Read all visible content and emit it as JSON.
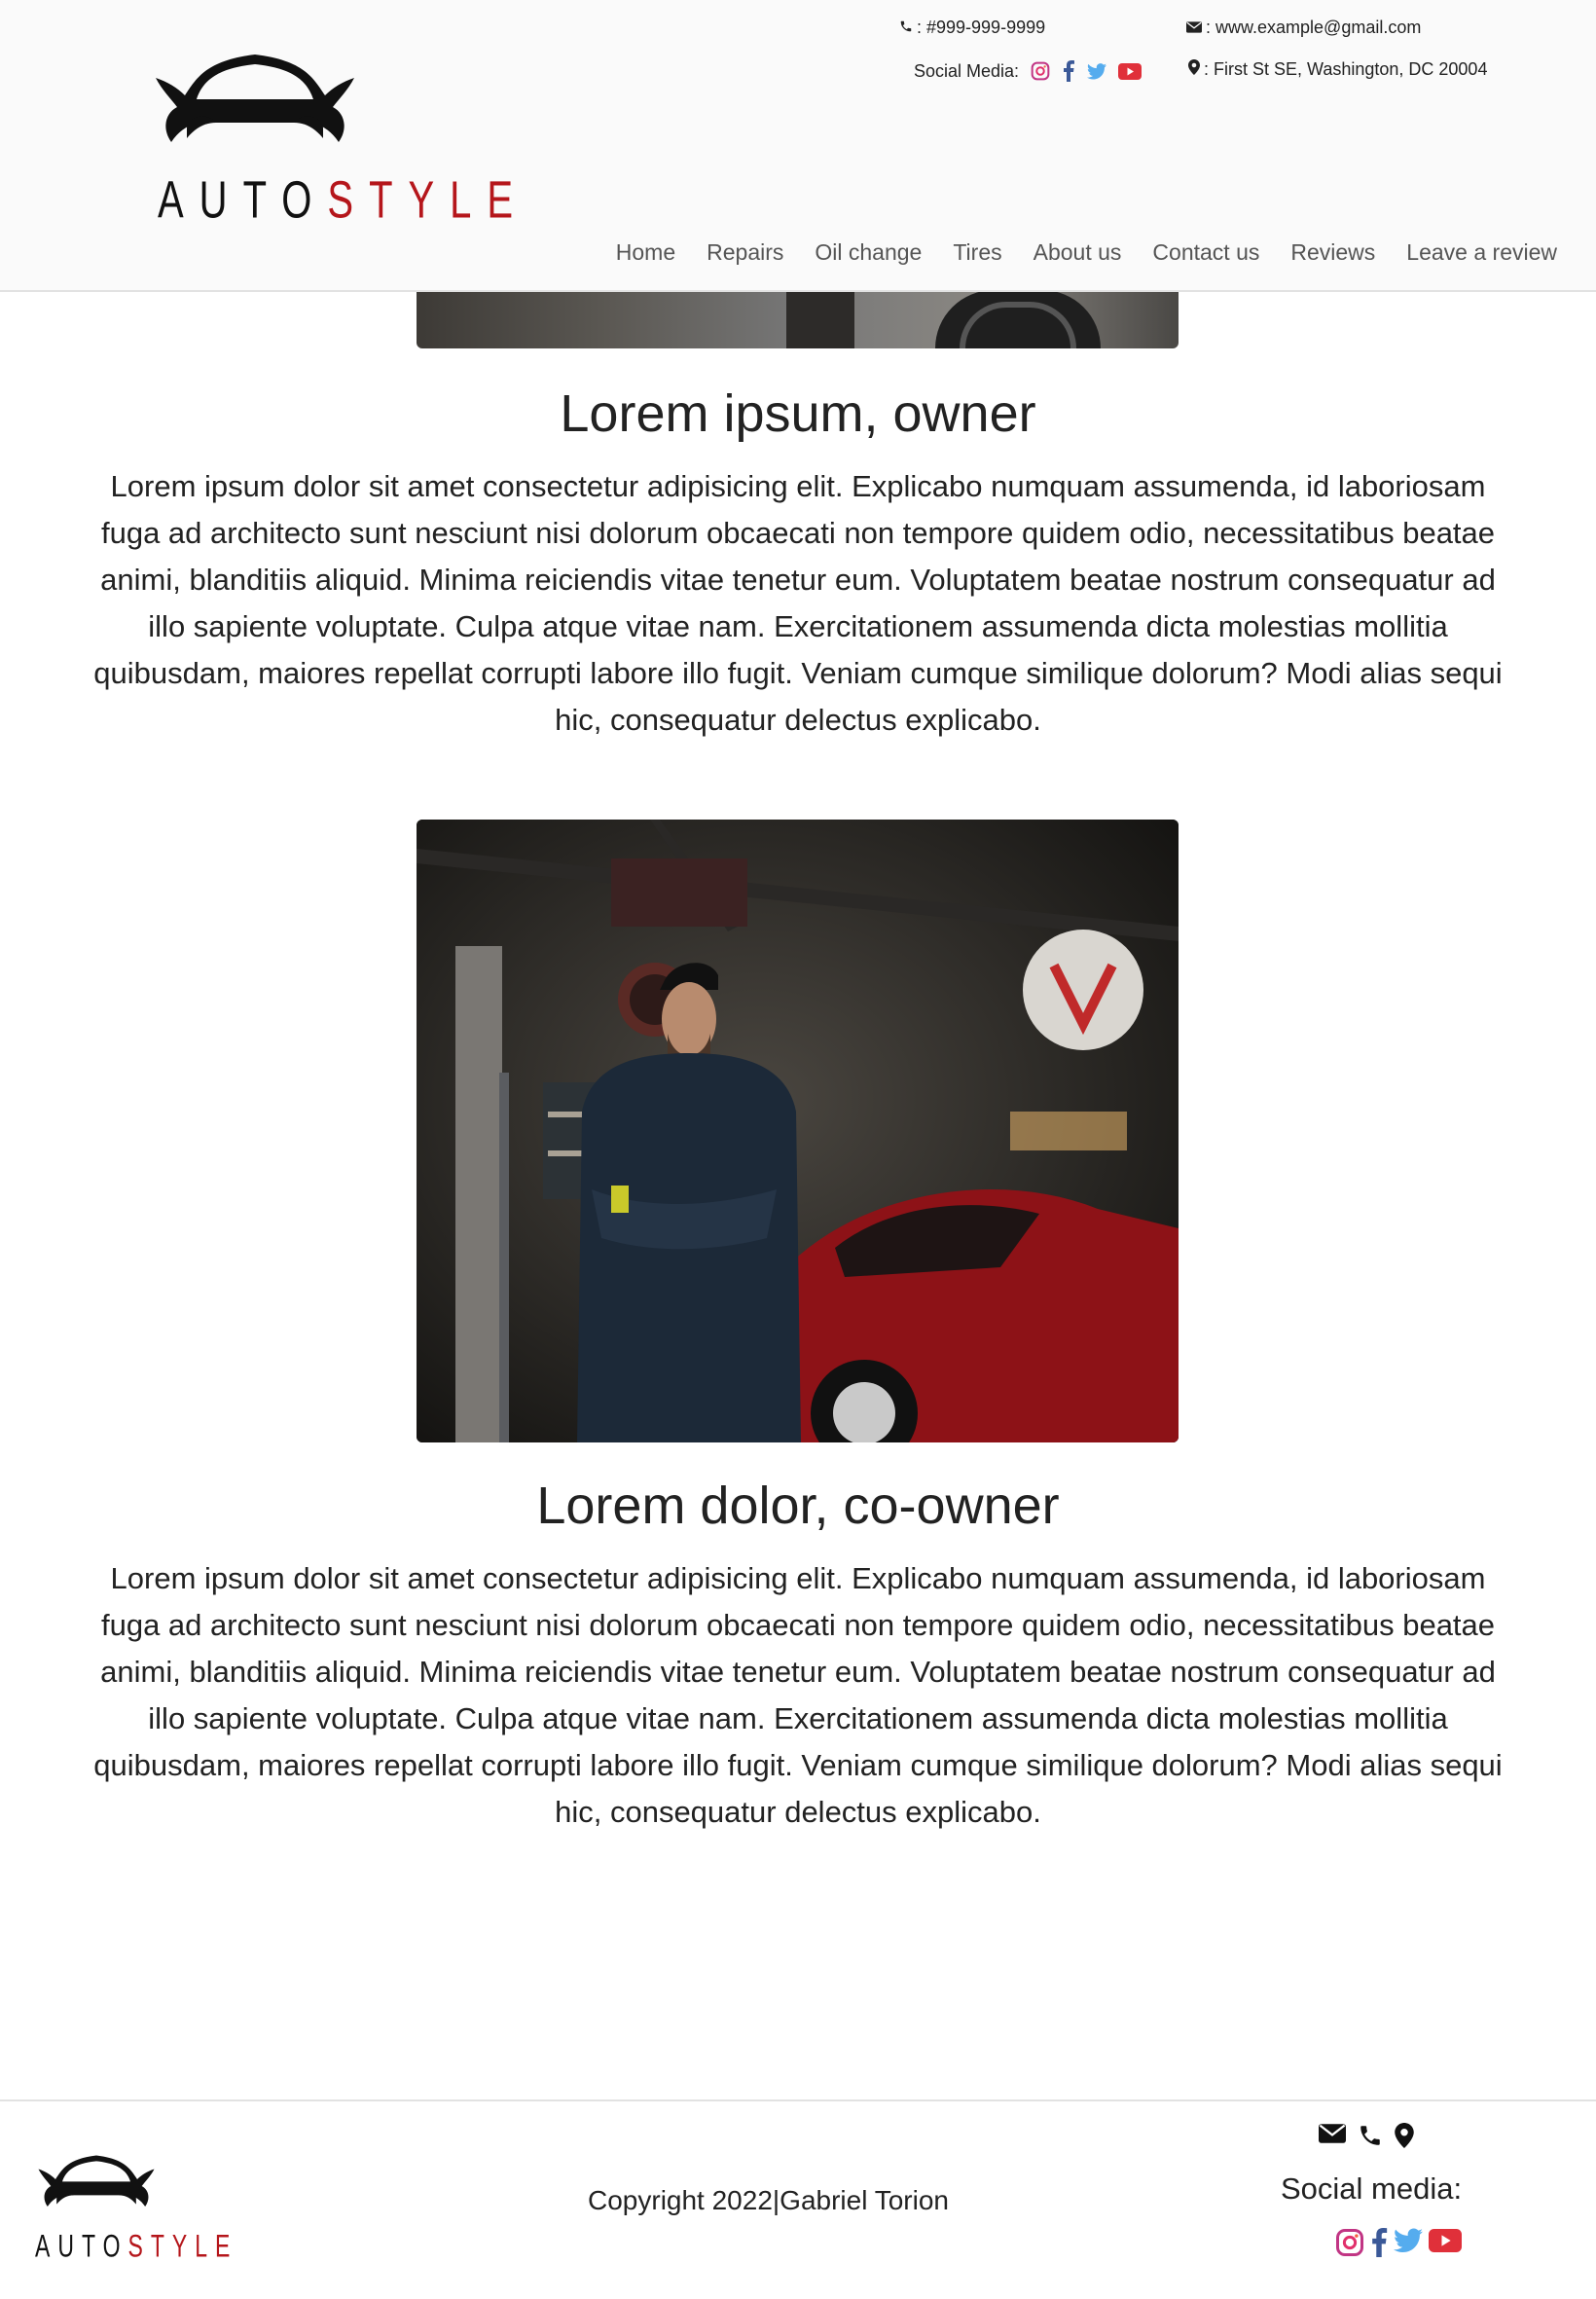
{
  "header": {
    "brand": {
      "part1": "AUTO",
      "part2": "STYLE"
    },
    "phone": ": #999-999-9999",
    "email": ": www.example@gmail.com",
    "address": ": First St SE, Washington, DC 20004",
    "social_label": "Social Media:",
    "social_icons": [
      "instagram-icon",
      "facebook-icon",
      "twitter-icon",
      "youtube-icon"
    ]
  },
  "nav": {
    "items": [
      {
        "label": "Home"
      },
      {
        "label": "Repairs"
      },
      {
        "label": "Oil change"
      },
      {
        "label": "Tires"
      },
      {
        "label": "About us"
      },
      {
        "label": "Contact us"
      },
      {
        "label": "Reviews"
      },
      {
        "label": "Leave a review"
      }
    ]
  },
  "profiles": [
    {
      "title": "Lorem ipsum, owner",
      "body": "Lorem ipsum dolor sit amet consectetur adipisicing elit. Explicabo numquam assumenda, id laboriosam fuga ad architecto sunt nesciunt nisi dolorum obcaecati non tempore quidem odio, necessitatibus beatae animi, blanditiis aliquid. Minima reiciendis vitae tenetur eum. Voluptatem beatae nostrum consequatur ad illo sapiente voluptate. Culpa atque vitae nam. Exercitationem assumenda dicta molestias mollitia quibusdam, maiores repellat corrupti labore illo fugit. Veniam cumque similique dolorum? Modi alias sequi hic, consequatur delectus explicabo."
    },
    {
      "title": "Lorem dolor, co-owner",
      "body": "Lorem ipsum dolor sit amet consectetur adipisicing elit. Explicabo numquam assumenda, id laboriosam fuga ad architecto sunt nesciunt nisi dolorum obcaecati non tempore quidem odio, necessitatibus beatae animi, blanditiis aliquid. Minima reiciendis vitae tenetur eum. Voluptatem beatae nostrum consequatur ad illo sapiente voluptate. Culpa atque vitae nam. Exercitationem assumenda dicta molestias mollitia quibusdam, maiores repellat corrupti labore illo fugit. Veniam cumque similique dolorum? Modi alias sequi hic, consequatur delectus explicabo."
    }
  ],
  "footer": {
    "brand": {
      "part1": "AUTO",
      "part2": "STYLE"
    },
    "copyright": "Copyright 2022|Gabriel Torion",
    "contact_icons": [
      "email-icon",
      "phone-icon",
      "location-icon"
    ],
    "social_label": "Social media:",
    "social_icons": [
      "instagram-icon",
      "facebook-icon",
      "twitter-icon",
      "youtube-icon"
    ]
  },
  "colors": {
    "brand_red": "#b5161b",
    "instagram": "#c13584",
    "facebook": "#3b5998",
    "twitter": "#55acee",
    "youtube": "#e0303a"
  }
}
